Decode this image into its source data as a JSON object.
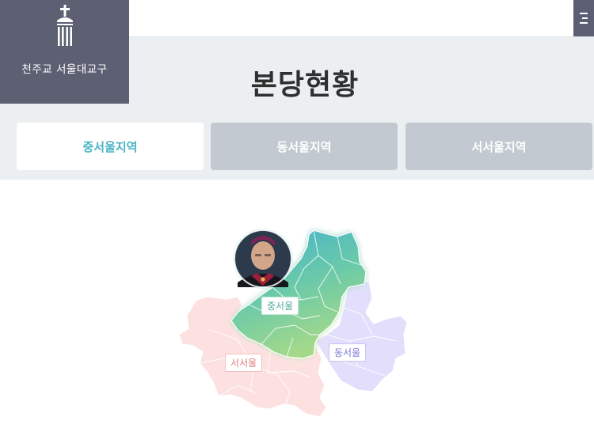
{
  "logo": {
    "text": "천주교 서울대교구"
  },
  "page": {
    "title": "본당현황"
  },
  "tabs": [
    {
      "label": "중서울지역",
      "active": true
    },
    {
      "label": "동서울지역",
      "active": false
    },
    {
      "label": "서서울지역",
      "active": false
    }
  ],
  "map": {
    "regions": [
      {
        "label": "중서울",
        "color": "#5fc3a5"
      },
      {
        "label": "동서울",
        "color": "#dcd8fb"
      },
      {
        "label": "서서울",
        "color": "#fde1e1"
      }
    ]
  },
  "icons": {
    "logo": "cathedral-emblem-icon",
    "menu": "menu-icon",
    "avatar": "bishop-portrait"
  }
}
